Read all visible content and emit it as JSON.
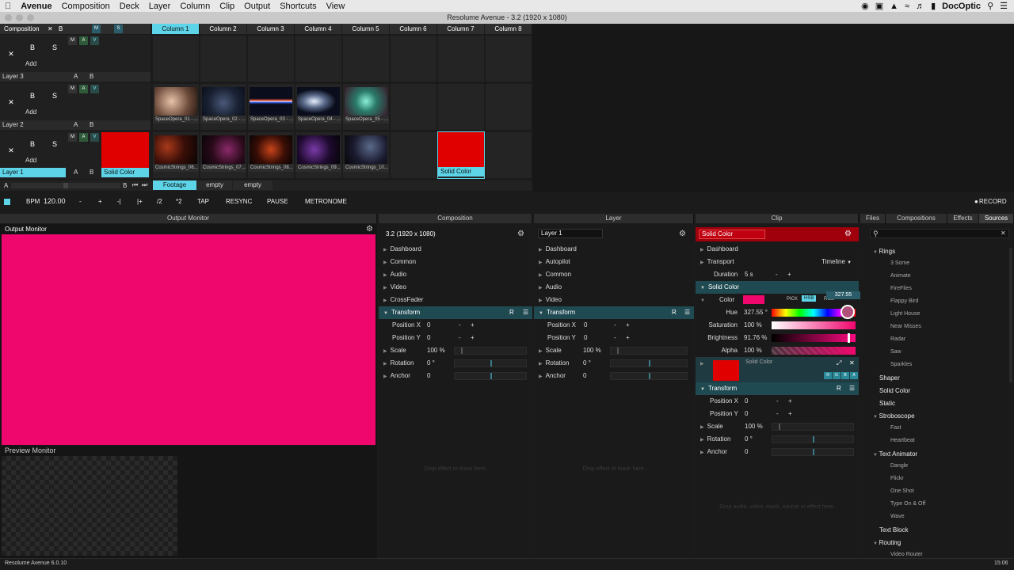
{
  "menubar": {
    "app": "Avenue",
    "items": [
      "Composition",
      "Deck",
      "Layer",
      "Column",
      "Clip",
      "Output",
      "Shortcuts",
      "View"
    ],
    "right_user": "DocOptic"
  },
  "window_title": "Resolume Avenue - 3.2 (1920 x 1080)",
  "composition": {
    "label": "Composition",
    "b": "B",
    "m": "M",
    "s": "S",
    "close": "✕"
  },
  "columns": [
    "Column 1",
    "Column 2",
    "Column 3",
    "Column 4",
    "Column 5",
    "Column 6",
    "Column 7",
    "Column 8"
  ],
  "layer_controls": {
    "b": "B",
    "s": "S",
    "add": "Add",
    "m": "M",
    "a": "A",
    "v": "V",
    "x": "✕",
    "ab_a": "A",
    "ab_b": "B"
  },
  "layers": [
    {
      "name": "Layer 3",
      "clips": []
    },
    {
      "name": "Layer 2",
      "clips": [
        "SpaceOpera_01 - ...",
        "SpaceOpera_02 - ...",
        "SpaceOpera_03 - ...",
        "SpaceOpera_04 - ...",
        "SpaceOpera_05 - ..."
      ]
    },
    {
      "name": "Layer 1",
      "first_clip": "Solid Color",
      "clips": [
        "CosmicStrings_06...",
        "CosmicStrings_07...",
        "CosmicStrings_08...",
        "CosmicStrings_09...",
        "CosmicStrings_10..."
      ],
      "col7_clip": "Solid Color"
    }
  ],
  "deckbar": {
    "a": "A",
    "b": "B",
    "decks": [
      "Footage",
      "empty",
      "empty"
    ]
  },
  "transport": {
    "bpm_label": "BPM",
    "bpm": "120.00",
    "minus": "-",
    "plus": "+",
    "prev": "-|",
    "next": "|+",
    "half": "/2",
    "double": "*2",
    "tap": "TAP",
    "resync": "RESYNC",
    "pause": "PAUSE",
    "metronome": "METRONOME",
    "record": "RECORD"
  },
  "output_monitor": {
    "header": "Output Monitor",
    "title": "Output Monitor",
    "preview": "Preview Monitor",
    "color": "#f0076e"
  },
  "composition_panel": {
    "header": "Composition",
    "name": "3.2 (1920 x 1080)",
    "sections": [
      "Dashboard",
      "Common",
      "Audio",
      "Video",
      "CrossFader"
    ],
    "transform": "Transform",
    "posx_label": "Position X",
    "posx": "0",
    "posy_label": "Position Y",
    "posy": "0",
    "scale_label": "Scale",
    "scale": "100 %",
    "rotation_label": "Rotation",
    "rotation": "0 °",
    "anchor_label": "Anchor",
    "anchor": "0",
    "drop": "Drop effect or mask here.",
    "r": "R",
    "minus": "-",
    "plus": "+"
  },
  "layer_panel": {
    "header": "Layer",
    "name": "Layer 1",
    "sections": [
      "Dashboard",
      "Autopilot",
      "Common",
      "Audio",
      "Video"
    ],
    "transform": "Transform",
    "posx_label": "Position X",
    "posx": "0",
    "posy_label": "Position Y",
    "posy": "0",
    "scale_label": "Scale",
    "scale": "100 %",
    "rotation_label": "Rotation",
    "rotation": "0 °",
    "anchor_label": "Anchor",
    "anchor": "0",
    "drop": "Drop effect or mask here.",
    "r": "R",
    "minus": "-",
    "plus": "+"
  },
  "clip_panel": {
    "header": "Clip",
    "name": "Solid Color",
    "dashboard": "Dashboard",
    "transport": "Transport",
    "timeline": "Timeline",
    "duration_label": "Duration",
    "duration": "5 s",
    "solid_color": "Solid Color",
    "color_label": "Color",
    "pick": "PICK",
    "hsb": "HSB",
    "rgb": "RGB",
    "hue_label": "Hue",
    "hue": "327.55 °",
    "hue_tooltip": "327.55",
    "saturation_label": "Saturation",
    "saturation": "100 %",
    "brightness_label": "Brightness",
    "brightness": "91.76 %",
    "alpha_label": "Alpha",
    "alpha": "100 %",
    "source_name": "Solid Color",
    "rgba": [
      "R",
      "G",
      "B",
      "A"
    ],
    "transform": "Transform",
    "posx_label": "Position X",
    "posx": "0",
    "posy_label": "Position Y",
    "posy": "0",
    "scale_label": "Scale",
    "scale": "100 %",
    "rotation_label": "Rotation",
    "rotation": "0 °",
    "anchor_label": "Anchor",
    "anchor": "0",
    "drop": "Drop audio, video, mask, source or effect here.",
    "r": "R",
    "minus": "-",
    "plus": "+",
    "swatch_color": "#f0076e",
    "hue_fraction": 0.91,
    "brightness_fraction": 0.92
  },
  "sources_panel": {
    "tabs": [
      "Files",
      "Compositions",
      "Effects",
      "Sources"
    ],
    "tree": [
      {
        "label": "Rings",
        "kind": "group",
        "children": [
          "3 Some",
          "Animate",
          "FireFlies",
          "Flappy Bird",
          "Light House",
          "Near Misses",
          "Radar",
          "Saw",
          "Sparkles"
        ]
      },
      {
        "label": "Shaper",
        "kind": "item"
      },
      {
        "label": "Solid Color",
        "kind": "item"
      },
      {
        "label": "Static",
        "kind": "item"
      },
      {
        "label": "Stroboscope",
        "kind": "group",
        "children": [
          "Fast",
          "Heartbeat"
        ]
      },
      {
        "label": "Text Animator",
        "kind": "group",
        "children": [
          "Dangle",
          "Flickr",
          "One Shot",
          "Type On & Off",
          "Wave"
        ]
      },
      {
        "label": "Text Block",
        "kind": "item"
      },
      {
        "label": "Routing",
        "kind": "group",
        "children": [
          "Video Router"
        ]
      }
    ]
  },
  "statusbar": {
    "version": "Resolume Avenue 6.0.10",
    "time": "15:06"
  }
}
